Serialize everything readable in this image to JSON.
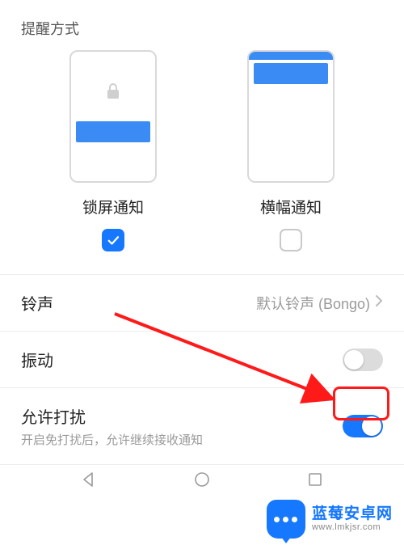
{
  "section": {
    "title": "提醒方式"
  },
  "notif_styles": {
    "lock": {
      "label": "锁屏通知",
      "checked": true
    },
    "banner": {
      "label": "横幅通知",
      "checked": false
    }
  },
  "rows": {
    "ringtone": {
      "title": "铃声",
      "value": "默认铃声 (Bongo)"
    },
    "vibrate": {
      "title": "振动",
      "on": false
    },
    "allow_disturb": {
      "title": "允许打扰",
      "subtitle": "开启免打扰后，允许继续接收通知",
      "on": true
    }
  },
  "watermark": {
    "line1": "蓝莓安卓网",
    "line2": "www.lmkjsr.com"
  }
}
